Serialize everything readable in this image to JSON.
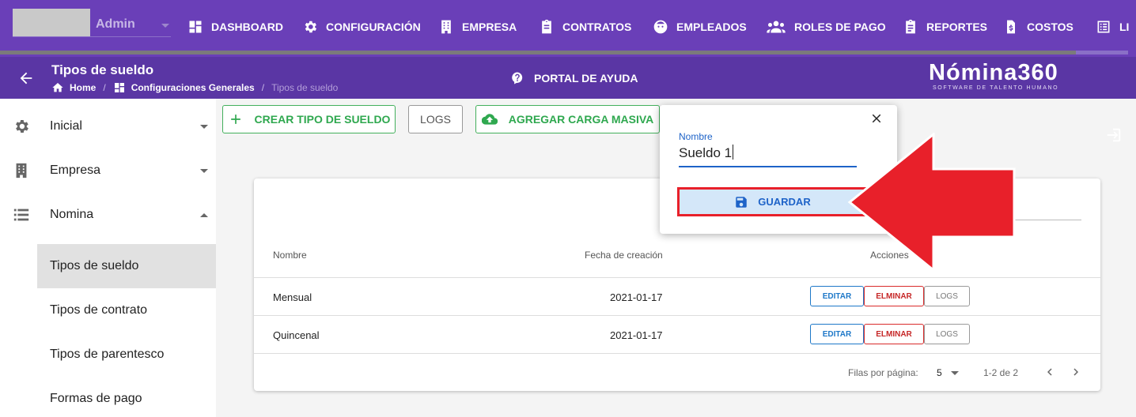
{
  "topbar": {
    "user_label": "Admin",
    "nav": [
      {
        "label": "DASHBOARD",
        "icon": "dashboard-icon"
      },
      {
        "label": "CONFIGURACIÓN",
        "icon": "gear-icon"
      },
      {
        "label": "EMPRESA",
        "icon": "building-icon"
      },
      {
        "label": "CONTRATOS",
        "icon": "clipboard-icon"
      },
      {
        "label": "EMPLEADOS",
        "icon": "face-icon"
      },
      {
        "label": "ROLES DE PAGO",
        "icon": "people-icon"
      },
      {
        "label": "REPORTES",
        "icon": "clipboard-list-icon"
      },
      {
        "label": "COSTOS",
        "icon": "invoice-icon"
      },
      {
        "label": "LI",
        "icon": "list-icon"
      }
    ]
  },
  "header": {
    "title": "Tipos de sueldo",
    "breadcrumb": [
      "Home",
      "Configuraciones Generales",
      "Tipos de sueldo"
    ],
    "help_label": "PORTAL DE AYUDA",
    "logo": "Nómina360",
    "logo_tagline": "SOFTWARE DE TALENTO HUMANO"
  },
  "sidebar": {
    "items": [
      {
        "label": "Inicial",
        "icon": "gear-icon",
        "expanded": false
      },
      {
        "label": "Empresa",
        "icon": "building-icon",
        "expanded": false
      },
      {
        "label": "Nomina",
        "icon": "list-icon",
        "expanded": true
      }
    ],
    "subitems": [
      {
        "label": "Tipos de sueldo",
        "active": true
      },
      {
        "label": "Tipos de contrato",
        "active": false
      },
      {
        "label": "Tipos de parentesco",
        "active": false
      },
      {
        "label": "Formas de pago",
        "active": false
      }
    ]
  },
  "toolbar": {
    "create_label": "CREAR TIPO DE SUELDO",
    "logs_label": "LOGS",
    "bulk_label": "AGREGAR CARGA MASIVA"
  },
  "table": {
    "columns": [
      "Nombre",
      "Fecha de creación",
      "Acciones"
    ],
    "rows": [
      {
        "nombre": "Mensual",
        "fecha": "2021-01-17"
      },
      {
        "nombre": "Quincenal",
        "fecha": "2021-01-17"
      }
    ],
    "actions": {
      "edit": "EDITAR",
      "delete": "ELMINAR",
      "logs": "LOGS"
    },
    "footer": {
      "rows_per_page_label": "Filas por página:",
      "rows_per_page_value": "5",
      "range": "1-2 de 2"
    }
  },
  "popup": {
    "field_label": "Nombre",
    "field_value": "Sueldo 1",
    "save_label": "GUARDAR"
  },
  "colors": {
    "topbar": "#6a3fb8",
    "header": "#5a36a4",
    "green": "#2fa84f",
    "blue": "#1e63c8",
    "red_arrow": "#e8202a"
  }
}
